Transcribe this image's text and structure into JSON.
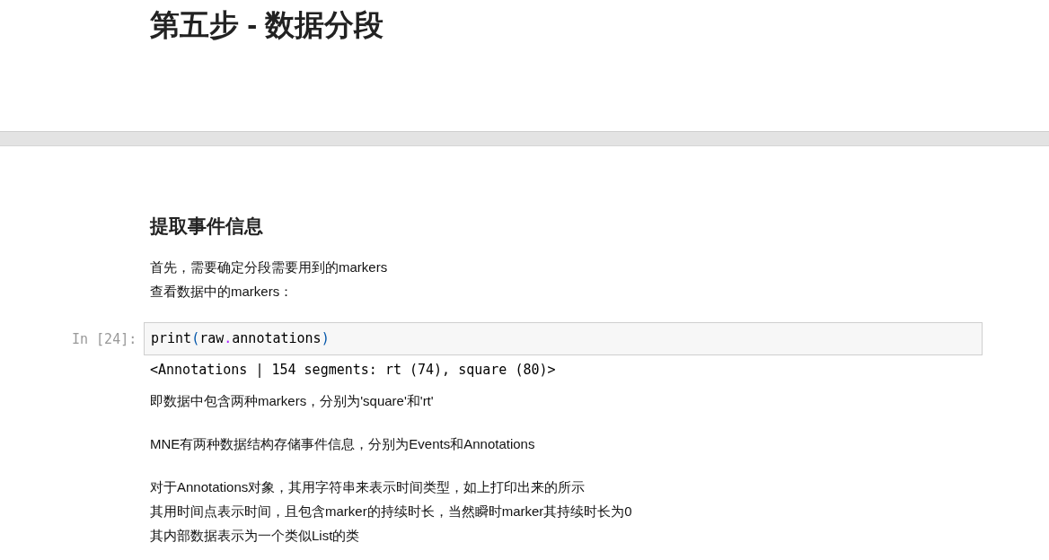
{
  "header": {
    "title": "第五步 - 数据分段"
  },
  "cells": [
    {
      "kind": "markdown",
      "heading": "提取事件信息",
      "paragraphs": [
        [
          "首先，需要确定分段需要用到的markers",
          "查看数据中的markers："
        ]
      ]
    },
    {
      "kind": "code",
      "prompt": "In [24]:",
      "code": [
        {
          "text": "print",
          "kind": "name"
        },
        {
          "text": "(",
          "kind": "paren"
        },
        {
          "text": "raw",
          "kind": "name"
        },
        {
          "text": ".",
          "kind": "operator"
        },
        {
          "text": "annotations",
          "kind": "name"
        },
        {
          "text": ")",
          "kind": "paren"
        }
      ],
      "output": "<Annotations | 154 segments: rt (74), square (80)>"
    },
    {
      "kind": "markdown",
      "paragraphs": [
        [
          "即数据中包含两种markers，分别为'square'和'rt'"
        ],
        [
          "MNE有两种数据结构存储事件信息，分别为Events和Annotations"
        ],
        [
          "对于Annotations对象，其用字符串来表示时间类型，如上打印出来的所示",
          "其用时间点表示时间，且包含marker的持续时长，当然瞬时marker其持续时长为0",
          "其内部数据表示为一个类似List的类"
        ]
      ]
    }
  ]
}
